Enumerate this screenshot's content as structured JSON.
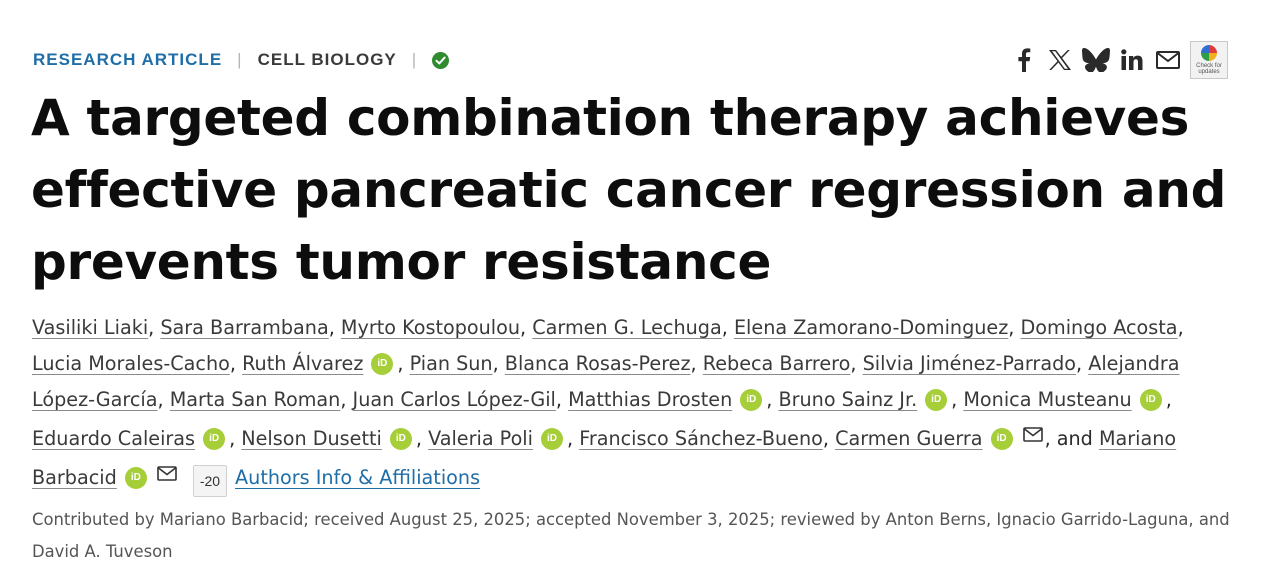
{
  "meta": {
    "article_type": "RESEARCH ARTICLE",
    "separator": "|",
    "subject": "CELL BIOLOGY"
  },
  "share": {
    "icons": [
      "facebook-icon",
      "x-icon",
      "bluesky-icon",
      "linkedin-icon",
      "email-icon"
    ],
    "updates_badge_text": "Check for updates"
  },
  "title": "A targeted combination therapy achieves effective pancreatic cancer regression and prevents tumor resistance",
  "authors": [
    {
      "name": "Vasiliki Liaki"
    },
    {
      "name": "Sara Barrambana"
    },
    {
      "name": "Myrto Kostopoulou"
    },
    {
      "name": "Carmen G. Lechuga"
    },
    {
      "name": "Elena Zamorano-Dominguez"
    },
    {
      "name": "Domingo Acosta"
    },
    {
      "name": "Lucia Morales-Cacho"
    },
    {
      "name": "Ruth Álvarez",
      "orcid": true
    },
    {
      "name": "Pian Sun"
    },
    {
      "name": "Blanca Rosas-Perez"
    },
    {
      "name": "Rebeca Barrero"
    },
    {
      "name": "Silvia Jiménez-Parrado"
    },
    {
      "name": "Alejandra López-García"
    },
    {
      "name": "Marta San Roman"
    },
    {
      "name": "Juan Carlos López-Gil"
    },
    {
      "name": "Matthias Drosten",
      "orcid": true
    },
    {
      "name": "Bruno Sainz Jr.",
      "orcid": true
    },
    {
      "name": "Monica Musteanu",
      "orcid": true
    },
    {
      "name": "Eduardo Caleiras",
      "orcid": true
    },
    {
      "name": "Nelson Dusetti",
      "orcid": true
    },
    {
      "name": "Valeria Poli",
      "orcid": true
    },
    {
      "name": "Francisco Sánchez-Bueno"
    },
    {
      "name": "Carmen Guerra",
      "orcid": true,
      "email": true
    },
    {
      "name": "Mariano Barbacid",
      "orcid": true,
      "email": true
    }
  ],
  "orcid_label": "iD",
  "author_separator": ", ",
  "and_word": ", and ",
  "more_authors_label": "-20",
  "affiliations_link": "Authors Info & Affiliations",
  "contributed_text": "Contributed by Mariano Barbacid; received August 25, 2025; accepted November 3, 2025; reviewed by Anton Berns, Ignacio Garrido-Laguna, and David A. Tuveson",
  "colors": {
    "accent": "#1f6ea8",
    "orcid": "#a6ce39",
    "verified": "#2e8b2e"
  }
}
